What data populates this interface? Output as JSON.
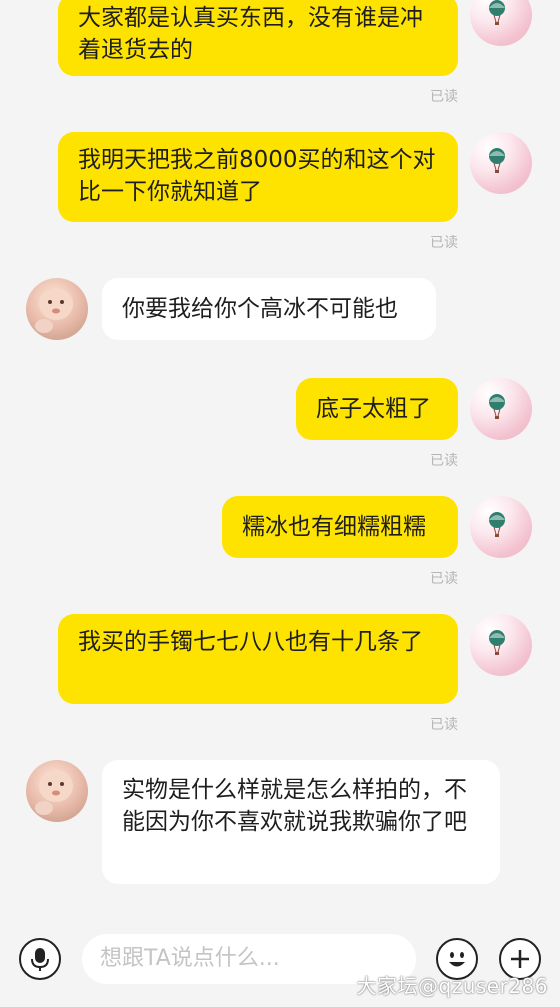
{
  "messages": [
    {
      "side": "sent",
      "text": "大家都是认真买东西，没有谁是冲着退货去的",
      "read": "已读"
    },
    {
      "side": "sent",
      "text": "我明天把我之前8000买的和这个对比一下你就知道了",
      "read": "已读"
    },
    {
      "side": "recv",
      "text": "你要我给你个高冰不可能也"
    },
    {
      "side": "sent",
      "text": "底子太粗了",
      "read": "已读"
    },
    {
      "side": "sent",
      "text": "糯冰也有细糯粗糯",
      "read": "已读"
    },
    {
      "side": "sent",
      "text": "我买的手镯七七八八也有十几条了",
      "read": "已读"
    },
    {
      "side": "recv",
      "text": "实物是什么样就是怎么样拍的，不能因为你不喜欢就说我欺骗你了吧"
    }
  ],
  "input": {
    "placeholder": "想跟TA说点什么..."
  },
  "watermark": "大家坛@qzuser286",
  "icons": {
    "voice": "microphone-icon",
    "emoji": "emoji-icon",
    "more": "plus-icon"
  },
  "colors": {
    "sent_bubble": "#ffe300",
    "recv_bubble": "#ffffff",
    "background": "#f4f4f4"
  }
}
